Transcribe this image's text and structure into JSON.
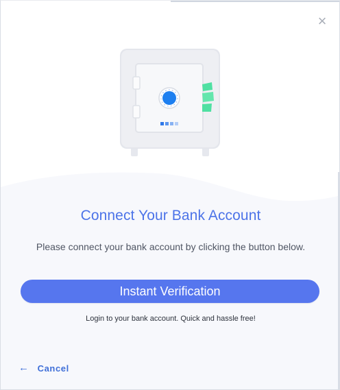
{
  "dialog": {
    "close_symbol": "×",
    "close_icon": "close-icon",
    "illustration": "bank-safe",
    "title": "Connect Your Bank Account",
    "subtitle": "Please connect your bank account by clicking the button below.",
    "primary_button": "Instant Verification",
    "note": "Login to your bank account. Quick and hassle free!",
    "cancel_label": "Cancel",
    "cancel_icon": "arrow-left-icon",
    "cancel_symbol": "←"
  },
  "colors": {
    "accent": "#5676ee",
    "title": "#4c73e8",
    "link": "#3f6fd8",
    "safe_dial": "#1d7ff0",
    "cash": "#4fe0a2"
  }
}
